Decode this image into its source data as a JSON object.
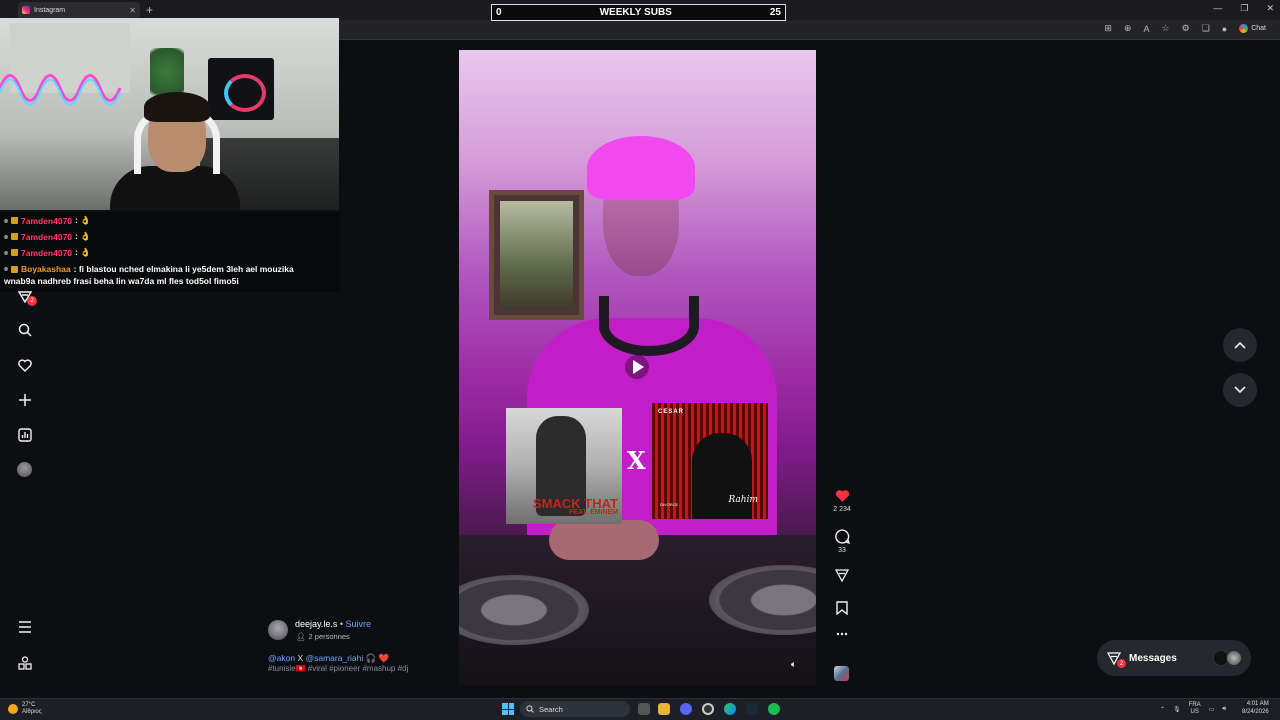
{
  "browser": {
    "tab_title": "Instagram",
    "new_tab_label": "+",
    "window_controls": [
      "—",
      "❐",
      "✕"
    ],
    "chat_label": "Chat"
  },
  "overlay": {
    "subs_title": "WEEKLY SUBS",
    "subs_left": "0",
    "subs_right": "25"
  },
  "chat": {
    "messages": [
      {
        "user": "7amden4070",
        "text": ": 👌"
      },
      {
        "user": "7amden4070",
        "text": ": 👌"
      },
      {
        "user": "7amden4070",
        "text": ": 👌"
      },
      {
        "user": "Boyakashaa",
        "text": ": fi blastou nched elmakina li ye5dem 3leh ael mouzika"
      }
    ],
    "wrap_line": "wnab9a nadhreb frasi beha lin wa7da ml fles tod5ol fimo5i"
  },
  "sidebar": {
    "notif_count": "2"
  },
  "reel": {
    "album1_title": "SMACK THAT",
    "album1_sub": "FEAT. EMINEM",
    "album_x": "X",
    "album2_brand": "CESAR",
    "album2_sig": "Rahim",
    "album2_sub": "DIVORCE",
    "likes": "2 234",
    "comments": "33"
  },
  "caption": {
    "username": "deejay.le.s",
    "separator": "•",
    "follow": "Suivre",
    "people": "2 personnes",
    "mention1": "@akon",
    "x": "X",
    "mention2": "@samara_riahi",
    "emoji": "🎧 ❤️",
    "tags": "#tunisie🇹🇳 #viral #pioneer #mashup #dj"
  },
  "messages": {
    "label": "Messages",
    "badge": "2"
  },
  "taskbar": {
    "weather_temp": "27°C",
    "weather_desc": "Αίθριος",
    "search_label": "Search",
    "lang": "FRA",
    "lang_sub": "US",
    "time": "4:01 AM",
    "date": "8/24/2026"
  },
  "colors": {
    "like": "#ff3040",
    "link": "#6ea8ff",
    "background": "#0c0e12"
  }
}
